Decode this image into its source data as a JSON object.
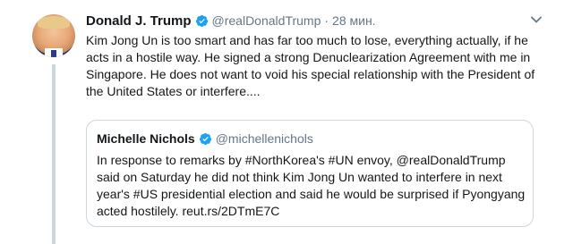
{
  "tweet": {
    "name": "Donald J. Trump",
    "handle": "@realDonaldTrump",
    "dot": "·",
    "time": "28 мин.",
    "text": "Kim Jong Un is too smart and has far too much to lose, everything actually, if he\nacts in a hostile way. He signed a strong Denuclearization Agreement with me in\nSingapore. He does not want to void his special relationship with the President of\nthe United States or interfere...."
  },
  "quote": {
    "name": "Michelle Nichols",
    "handle": "@michellenichols",
    "text": "In response to remarks by #NorthKorea's #UN envoy, @realDonaldTrump\nsaid on Saturday he did not think Kim Jong Un wanted to interfere in next\nyear's #US presidential election and said he would be surprised if Pyongyang\nacted hostilely. reut.rs/2DTmE7C"
  },
  "colors": {
    "verified": "#1da1f2",
    "secondary_text": "#657786",
    "border": "#ccd6dd"
  },
  "icons": {
    "verified": "verified-badge-icon",
    "menu": "chevron-down-icon"
  }
}
